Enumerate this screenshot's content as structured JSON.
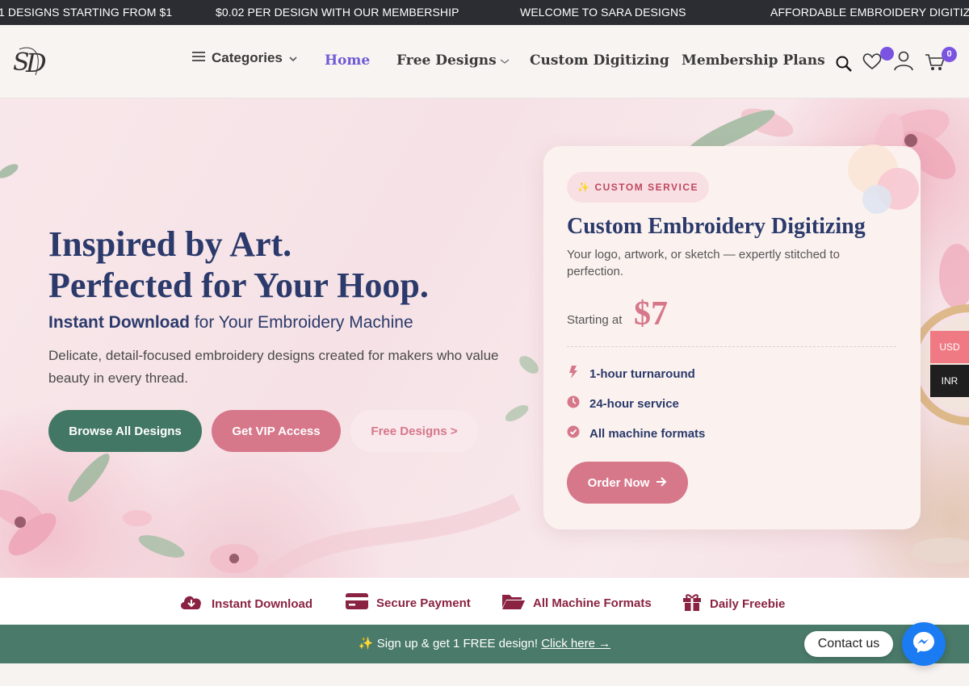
{
  "ticker": [
    "1 DESIGNS STARTING FROM $1",
    "$0.02 PER DESIGN WITH OUR MEMBERSHIP",
    "WELCOME TO SARA DESIGNS",
    "AFFORDABLE EMBROIDERY DIGITIZING"
  ],
  "header": {
    "categories_label": "Categories",
    "nav": [
      {
        "label": "Home",
        "active": true
      },
      {
        "label": "Free Designs",
        "has_dropdown": true
      },
      {
        "label": "Custom Digitizing"
      },
      {
        "label": "Membership Plans"
      }
    ],
    "cart_count": "0",
    "icons": [
      "menu-icon",
      "chevron-down-icon",
      "search-icon",
      "heart-icon",
      "user-icon",
      "cart-icon"
    ]
  },
  "hero": {
    "title_line1": "Inspired by Art.",
    "title_line2": "Perfected for Your Hoop.",
    "subtitle_bold": "Instant Download",
    "subtitle_rest": " for Your Embroidery Machine",
    "description": "Delicate, detail-focused embroidery designs created for makers who value beauty in every thread.",
    "buttons": {
      "browse": "Browse All Designs",
      "vip": "Get VIP Access",
      "free": "Free Designs >"
    }
  },
  "card": {
    "tag": "CUSTOM SERVICE",
    "title": "Custom Embroidery Digitizing",
    "description": "Your logo, artwork, or sketch — expertly stitched to perfection.",
    "price_label": "Starting at",
    "price": "$7",
    "features": [
      "1-hour turnaround",
      "24-hour service",
      "All machine formats"
    ],
    "order_button": "Order Now"
  },
  "currency": {
    "usd": "USD",
    "inr": "INR"
  },
  "features_strip": [
    {
      "label": "Instant Download",
      "icon": "cloud-download-icon"
    },
    {
      "label": "Secure Payment",
      "icon": "credit-card-icon"
    },
    {
      "label": "All Machine Formats",
      "icon": "folder-open-icon"
    },
    {
      "label": "Daily Freebie",
      "icon": "gift-icon"
    }
  ],
  "signup": {
    "text": "✨ Sign up & get 1 FREE design!",
    "link": "Click here →"
  },
  "contact": {
    "label": "Contact us"
  },
  "colors": {
    "navy": "#2b3a6b",
    "green": "#437765",
    "pink": "#d6778a",
    "purple": "#6f5bd6",
    "maroon": "#8a2342"
  }
}
